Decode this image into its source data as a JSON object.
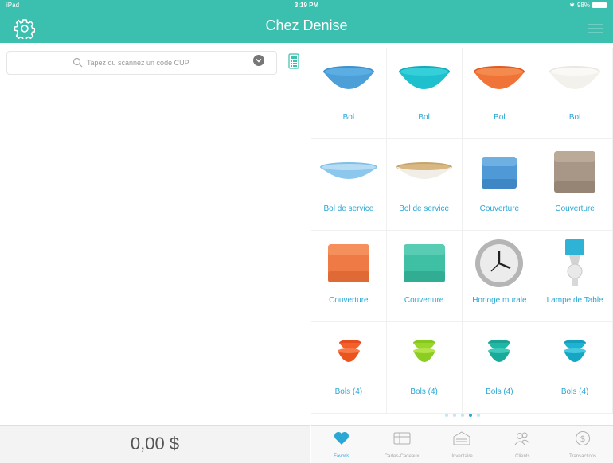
{
  "status": {
    "carrier": "iPad",
    "time": "3:19 PM",
    "battery": "98%"
  },
  "header": {
    "title": "Chez Denise"
  },
  "search": {
    "placeholder": "Tapez ou scannez un code CUP"
  },
  "totals": {
    "amount": "0,00 $"
  },
  "products": [
    {
      "label": "Bol",
      "icon": "bowl-blue"
    },
    {
      "label": "Bol",
      "icon": "bowl-teal"
    },
    {
      "label": "Bol",
      "icon": "bowl-orange"
    },
    {
      "label": "Bol",
      "icon": "bowl-white"
    },
    {
      "label": "Bol de service",
      "icon": "serving-bowl-blue"
    },
    {
      "label": "Bol de service",
      "icon": "serving-bowl-wood"
    },
    {
      "label": "Couverture",
      "icon": "blanket-blue"
    },
    {
      "label": "Couverture",
      "icon": "blanket-taupe"
    },
    {
      "label": "Couverture",
      "icon": "blanket-orange"
    },
    {
      "label": "Couverture",
      "icon": "blanket-mint"
    },
    {
      "label": "Horloge murale",
      "icon": "wall-clock"
    },
    {
      "label": "Lampe de Table",
      "icon": "table-lamp"
    },
    {
      "label": "Bols (4)",
      "icon": "bowls-stack-orange"
    },
    {
      "label": "Bols (4)",
      "icon": "bowls-stack-lime"
    },
    {
      "label": "Bols (4)",
      "icon": "bowls-stack-teal"
    },
    {
      "label": "Bols (4)",
      "icon": "bowls-stack-turquoise"
    }
  ],
  "pager": {
    "pages": 5,
    "current": 4
  },
  "tabs": [
    {
      "label": "Favoris",
      "icon": "heart-icon",
      "active": true
    },
    {
      "label": "Cartes-Cadeaux",
      "icon": "gift-card-icon",
      "active": false
    },
    {
      "label": "Inventaire",
      "icon": "inventory-icon",
      "active": false
    },
    {
      "label": "Clients",
      "icon": "clients-icon",
      "active": false
    },
    {
      "label": "Transactions",
      "icon": "dollar-icon",
      "active": false
    }
  ],
  "colors": {
    "header": "#3bbfae",
    "accent": "#2aa7d4"
  }
}
